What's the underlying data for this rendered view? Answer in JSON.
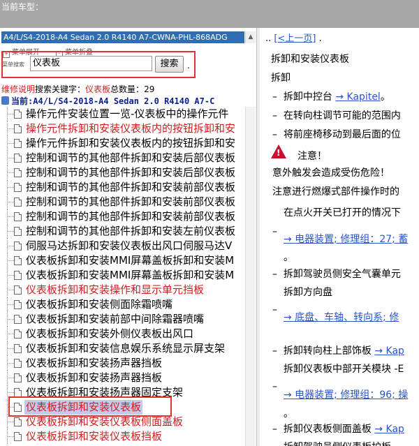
{
  "topbar": {
    "title": "当前车型："
  },
  "sidebar": {
    "model": "A4/L/S4-2018-A4 Sedan 2.0 R4140 A7-CWNA-PHL-868ADG",
    "expand_all": "菜单展开",
    "collapse_all": "菜单折叠",
    "search_label": "菜单搜索",
    "search_value": "仪表板",
    "search_button": "搜索",
    "dot": ".",
    "stats": {
      "link": "维修说明",
      "kw_label": "搜索关键字：",
      "kw": "仪表板",
      "count_label": "总数量：",
      "count": "29"
    },
    "current": "当前:A4/L/S4-2018-A4 Sedan 2.0 R4140 A7-C",
    "items": [
      "操作元件安装位置一览-仪表板中的操作元件",
      "操作元件拆卸和安装仪表板内的按钮拆卸和安",
      "操作元件拆卸和安装仪表板内的按钮拆卸和安",
      "控制和调节的其他部件拆卸和安装后部仪表板",
      "控制和调节的其他部件拆卸和安装后部仪表板",
      "控制和调节的其他部件拆卸和安装前部仪表板",
      "控制和调节的其他部件拆卸和安装前部仪表板",
      "控制和调节的其他部件拆卸和安装前部仪表板",
      "控制和调节的其他部件拆卸和安装左前仪表板",
      "伺服马达拆卸和安装仪表板出风口伺服马达V",
      "仪表板拆卸和安装MMI屏幕盖板拆卸和安装M",
      "仪表板拆卸和安装MMI屏幕盖板拆卸和安装M",
      "仪表板拆卸和安装操作和显示单元挡板",
      "仪表板拆卸和安装侧面除霜喷嘴",
      "仪表板拆卸和安装前部中间除霜器喷嘴",
      "仪表板拆卸和安装外侧仪表板出风口",
      "仪表板拆卸和安装信息娱乐系统显示屏支架",
      "仪表板拆卸和安装扬声器挡板",
      "仪表板拆卸和安装扬声器挡板",
      "仪表板拆卸和安装扬声器固定支架",
      "仪表板拆卸和安装仪表板",
      "仪表板拆卸和安装仪表板侧面盖板",
      "仪表板拆卸和安装仪表板挡板"
    ]
  },
  "content": {
    "prev_prefix": "..",
    "prev_link": "[<上一页]",
    "prev_suffix": ".",
    "title": "拆卸和安装仪表板",
    "section": "拆卸",
    "b1_text": "拆卸中控台",
    "b1_link": "→ Kapitel",
    "b1_end": "。",
    "b2": "在转向柱调节可能的范围内",
    "b3": "将前座椅移动到最后面的位",
    "warn_title": "注意！",
    "warn_line": "意外触发会造成受伤危险！",
    "note": "注意进行燃爆式部件操作时的",
    "note2": "在点火开关已打开的情况下",
    "ref1": "→ 电器装置; 修理组：27; 蓄",
    "period1": "。",
    "b4": "拆卸驾驶员侧安全气囊单元",
    "b4b": "拆卸方向盘",
    "ref2": "→ 底盘、车轴、转向系; 修",
    "b5_text": "拆卸转向柱上部饰板",
    "b5_link": "→ Kap",
    "b5b": "拆卸仪表板中部开关模块 -E",
    "ref3": "→ 电器装置; 修理组：96; 操",
    "period2": "。",
    "b6_text": "拆卸仪表板侧面盖板",
    "b6_link": "→ Kap",
    "b6b": "拆卸驾驶员侧仪表板护板"
  }
}
